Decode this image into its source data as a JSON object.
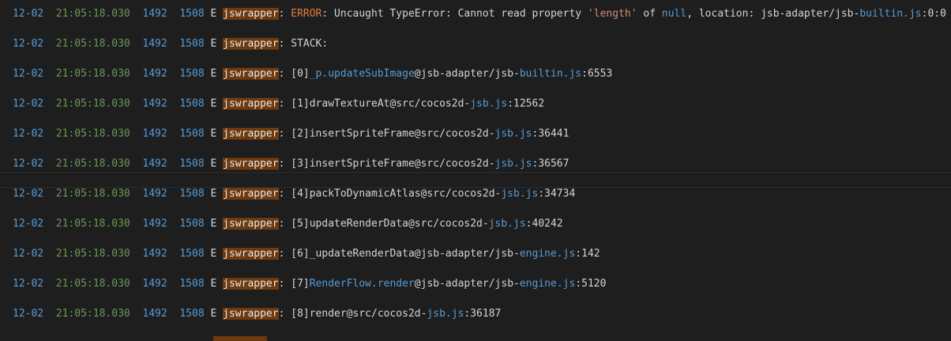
{
  "lines": [
    {
      "date": "12-02",
      "time": "21:05:18.030",
      "pid": "1492",
      "tid": "1508",
      "level": "E",
      "tag": "jswrapper",
      "sep": ": ",
      "m1": "",
      "m2": "ERROR",
      "m3": ": Uncaught TypeError: Cannot read property ",
      "m4": "'length'",
      "m5": " of ",
      "m6": "null",
      "m7": ", location: jsb-adapter/jsb-",
      "m8": "builtin.js",
      "m9": ":0:0"
    },
    {
      "date": "12-02",
      "time": "21:05:18.030",
      "pid": "1492",
      "tid": "1508",
      "level": "E",
      "tag": "jswrapper",
      "sep": ": ",
      "m1": "STACK:",
      "m2": "",
      "m3": "",
      "m4": "",
      "m5": "",
      "m6": "",
      "m7": "",
      "m8": "",
      "m9": ""
    },
    {
      "date": "12-02",
      "time": "21:05:18.030",
      "pid": "1492",
      "tid": "1508",
      "level": "E",
      "tag": "jswrapper",
      "sep": ": ",
      "m1": "[0]",
      "m2": "_p.updateSubImage",
      "m3": "@jsb-adapter/jsb-",
      "m4": "builtin.js",
      "m5": ":6553",
      "m6": "",
      "m7": "",
      "m8": "",
      "m9": ""
    },
    {
      "date": "12-02",
      "time": "21:05:18.030",
      "pid": "1492",
      "tid": "1508",
      "level": "E",
      "tag": "jswrapper",
      "sep": ": ",
      "m1": "[1]drawTextureAt@src/cocos2d-",
      "m2": "jsb.js",
      "m3": ":12562",
      "m4": "",
      "m5": "",
      "m6": "",
      "m7": "",
      "m8": "",
      "m9": ""
    },
    {
      "date": "12-02",
      "time": "21:05:18.030",
      "pid": "1492",
      "tid": "1508",
      "level": "E",
      "tag": "jswrapper",
      "sep": ": ",
      "m1": "[2]insertSpriteFrame@src/cocos2d-",
      "m2": "jsb.js",
      "m3": ":36441",
      "m4": "",
      "m5": "",
      "m6": "",
      "m7": "",
      "m8": "",
      "m9": ""
    },
    {
      "date": "12-02",
      "time": "21:05:18.030",
      "pid": "1492",
      "tid": "1508",
      "level": "E",
      "tag": "jswrapper",
      "sep": ": ",
      "m1": "[3]insertSpriteFrame@src/cocos2d-",
      "m2": "jsb.js",
      "m3": ":36567",
      "m4": "",
      "m5": "",
      "m6": "",
      "m7": "",
      "m8": "",
      "m9": ""
    },
    {
      "date": "12-02",
      "time": "21:05:18.030",
      "pid": "1492",
      "tid": "1508",
      "level": "E",
      "tag": "jswrapper",
      "sep": ": ",
      "m1": "[4]packToDynamicAtlas@src/cocos2d-",
      "m2": "jsb.js",
      "m3": ":34734",
      "m4": "",
      "m5": "",
      "m6": "",
      "m7": "",
      "m8": "",
      "m9": ""
    },
    {
      "date": "12-02",
      "time": "21:05:18.030",
      "pid": "1492",
      "tid": "1508",
      "level": "E",
      "tag": "jswrapper",
      "sep": ": ",
      "m1": "[5]updateRenderData@src/cocos2d-",
      "m2": "jsb.js",
      "m3": ":40242",
      "m4": "",
      "m5": "",
      "m6": "",
      "m7": "",
      "m8": "",
      "m9": ""
    },
    {
      "date": "12-02",
      "time": "21:05:18.030",
      "pid": "1492",
      "tid": "1508",
      "level": "E",
      "tag": "jswrapper",
      "sep": ": ",
      "m1": "[6]_updateRenderData@jsb-adapter/jsb-",
      "m2": "engine.js",
      "m3": ":142",
      "m4": "",
      "m5": "",
      "m6": "",
      "m7": "",
      "m8": "",
      "m9": ""
    },
    {
      "date": "12-02",
      "time": "21:05:18.030",
      "pid": "1492",
      "tid": "1508",
      "level": "E",
      "tag": "jswrapper",
      "sep": ": ",
      "m1": "[7]",
      "m2": "RenderFlow.render",
      "m3": "@jsb-adapter/jsb-",
      "m4": "engine.js",
      "m5": ":5120",
      "m6": "",
      "m7": "",
      "m8": "",
      "m9": ""
    },
    {
      "date": "12-02",
      "time": "21:05:18.030",
      "pid": "1492",
      "tid": "1508",
      "level": "E",
      "tag": "jswrapper",
      "sep": ": ",
      "m1": "[8]render@src/cocos2d-",
      "m2": "jsb.js",
      "m3": ":36187",
      "m4": "",
      "m5": "",
      "m6": "",
      "m7": "",
      "m8": "",
      "m9": ""
    }
  ]
}
